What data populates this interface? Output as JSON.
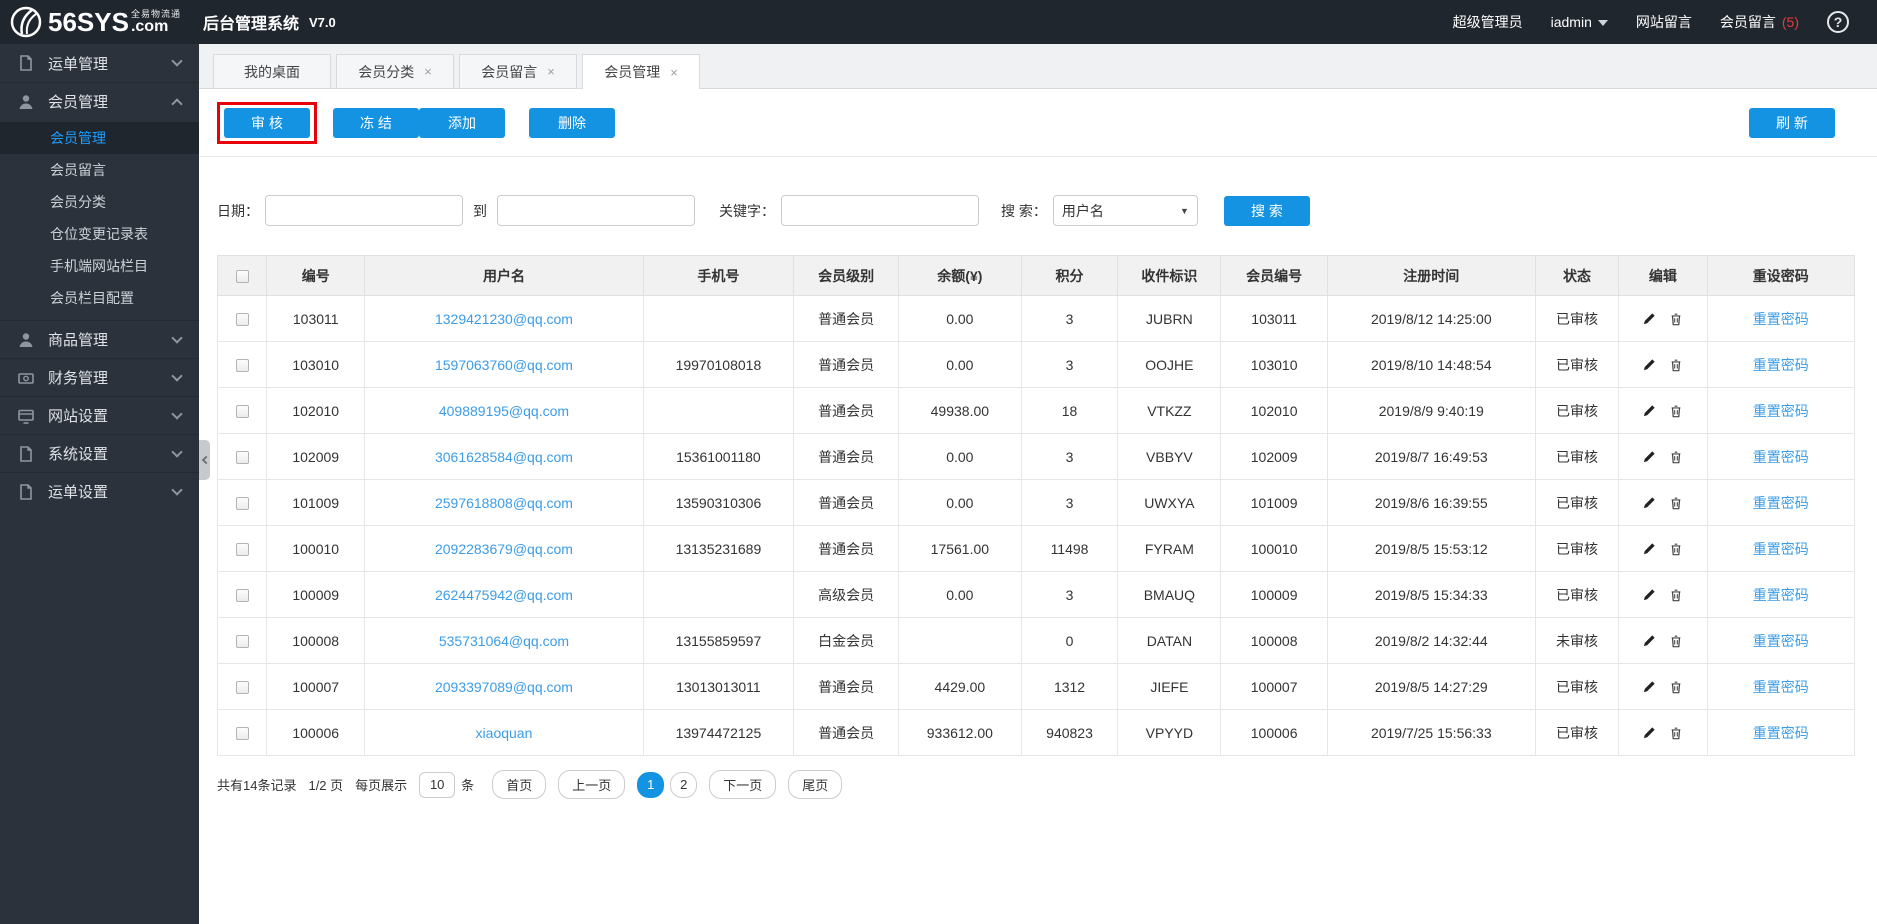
{
  "header": {
    "logo_text": "56SYS",
    "logo_tagline": "全易物流通",
    "logo_com": ".com",
    "app_title": "后台管理系统",
    "version": "V7.0",
    "role": "超级管理员",
    "username": "iadmin",
    "site_messages": "网站留言",
    "member_messages": "会员留言",
    "member_message_count": "(5)",
    "help": "?"
  },
  "sidebar": {
    "sections": [
      {
        "label": "运单管理",
        "icon": "document-icon",
        "expanded": false,
        "children": []
      },
      {
        "label": "会员管理",
        "icon": "user-icon",
        "expanded": true,
        "children": [
          {
            "label": "会员管理",
            "active": true
          },
          {
            "label": "会员留言",
            "active": false
          },
          {
            "label": "会员分类",
            "active": false
          },
          {
            "label": "仓位变更记录表",
            "active": false
          },
          {
            "label": "手机端网站栏目",
            "active": false
          },
          {
            "label": "会员栏目配置",
            "active": false
          }
        ]
      },
      {
        "label": "商品管理",
        "icon": "user-icon",
        "expanded": false,
        "children": []
      },
      {
        "label": "财务管理",
        "icon": "money-icon",
        "expanded": false,
        "children": []
      },
      {
        "label": "网站设置",
        "icon": "monitor-icon",
        "expanded": false,
        "children": []
      },
      {
        "label": "系统设置",
        "icon": "document-icon",
        "expanded": false,
        "children": []
      },
      {
        "label": "运单设置",
        "icon": "document-icon",
        "expanded": false,
        "children": []
      }
    ]
  },
  "tabs": [
    {
      "label": "我的桌面",
      "closable": false,
      "active": false
    },
    {
      "label": "会员分类",
      "closable": true,
      "active": false
    },
    {
      "label": "会员留言",
      "closable": true,
      "active": false
    },
    {
      "label": "会员管理",
      "closable": true,
      "active": true
    }
  ],
  "toolbar": {
    "audit": "审 核",
    "freeze": "冻 结",
    "add": "添加",
    "delete": "删除",
    "refresh": "刷 新"
  },
  "search": {
    "date_label": "日期：",
    "to_label": "到",
    "keyword_label": "关键字：",
    "search_label": "搜 索：",
    "type_selected": "用户名",
    "search_button": "搜 索"
  },
  "table": {
    "headers": [
      "编号",
      "用户名",
      "手机号",
      "会员级别",
      "余额(¥)",
      "积分",
      "收件标识",
      "会员编号",
      "注册时间",
      "状态",
      "编辑",
      "重设密码"
    ],
    "reset_link_label": "重置密码",
    "rows": [
      {
        "id": "103011",
        "username": "1329421230@qq.com",
        "phone": "",
        "level": "普通会员",
        "balance": "0.00",
        "points": "3",
        "code": "JUBRN",
        "member_no": "103011",
        "reg_time": "2019/8/12 14:25:00",
        "status": "已审核"
      },
      {
        "id": "103010",
        "username": "1597063760@qq.com",
        "phone": "19970108018",
        "level": "普通会员",
        "balance": "0.00",
        "points": "3",
        "code": "OOJHE",
        "member_no": "103010",
        "reg_time": "2019/8/10 14:48:54",
        "status": "已审核"
      },
      {
        "id": "102010",
        "username": "409889195@qq.com",
        "phone": "",
        "level": "普通会员",
        "balance": "49938.00",
        "points": "18",
        "code": "VTKZZ",
        "member_no": "102010",
        "reg_time": "2019/8/9 9:40:19",
        "status": "已审核"
      },
      {
        "id": "102009",
        "username": "3061628584@qq.com",
        "phone": "15361001180",
        "level": "普通会员",
        "balance": "0.00",
        "points": "3",
        "code": "VBBYV",
        "member_no": "102009",
        "reg_time": "2019/8/7 16:49:53",
        "status": "已审核"
      },
      {
        "id": "101009",
        "username": "2597618808@qq.com",
        "phone": "13590310306",
        "level": "普通会员",
        "balance": "0.00",
        "points": "3",
        "code": "UWXYA",
        "member_no": "101009",
        "reg_time": "2019/8/6 16:39:55",
        "status": "已审核"
      },
      {
        "id": "100010",
        "username": "2092283679@qq.com",
        "phone": "13135231689",
        "level": "普通会员",
        "balance": "17561.00",
        "points": "11498",
        "code": "FYRAM",
        "member_no": "100010",
        "reg_time": "2019/8/5 15:53:12",
        "status": "已审核"
      },
      {
        "id": "100009",
        "username": "2624475942@qq.com",
        "phone": "",
        "level": "高级会员",
        "balance": "0.00",
        "points": "3",
        "code": "BMAUQ",
        "member_no": "100009",
        "reg_time": "2019/8/5 15:34:33",
        "status": "已审核"
      },
      {
        "id": "100008",
        "username": "535731064@qq.com",
        "phone": "13155859597",
        "level": "白金会员",
        "balance": "",
        "points": "0",
        "code": "DATAN",
        "member_no": "100008",
        "reg_time": "2019/8/2 14:32:44",
        "status": "未审核"
      },
      {
        "id": "100007",
        "username": "2093397089@qq.com",
        "phone": "13013013011",
        "level": "普通会员",
        "balance": "4429.00",
        "points": "1312",
        "code": "JIEFE",
        "member_no": "100007",
        "reg_time": "2019/8/5 14:27:29",
        "status": "已审核"
      },
      {
        "id": "100006",
        "username": "xiaoquan",
        "phone": "13974472125",
        "level": "普通会员",
        "balance": "933612.00",
        "points": "940823",
        "code": "VPYYD",
        "member_no": "100006",
        "reg_time": "2019/7/25 15:56:33",
        "status": "已审核"
      }
    ]
  },
  "pagination": {
    "total_text": "共有14条记录",
    "page_text": "1/2 页",
    "per_page_label": "每页展示",
    "per_page": "10",
    "unit_label": "条",
    "first": "首页",
    "prev": "上一页",
    "pages": [
      "1",
      "2"
    ],
    "active_page": "1",
    "next": "下一页",
    "last": "尾页"
  },
  "colors": {
    "accent_blue": "#1593e3",
    "link_blue": "#3c9ce6",
    "annotation_red": "#e8000a",
    "header_bg": "#20262d",
    "sidebar_bg": "#2b323b",
    "badge_red": "#e23c3c"
  }
}
